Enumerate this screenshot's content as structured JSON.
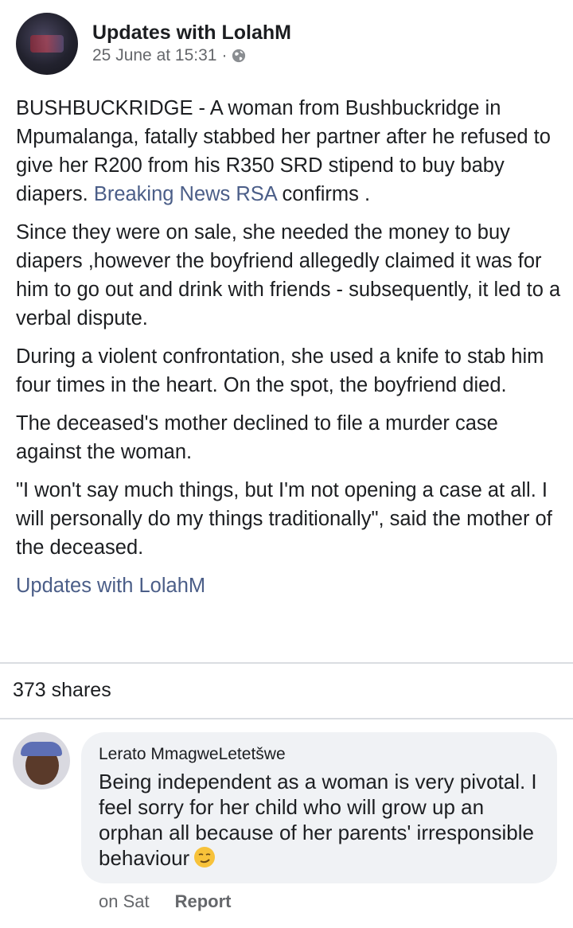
{
  "post": {
    "page_name": "Updates with LolahM",
    "timestamp": "25 June at 15:31",
    "privacy_icon": "globe-icon",
    "paragraphs": [
      {
        "text_before": "BUSHBUCKRIDGE - A woman from Bushbuckridge in Mpumalanga, fatally stabbed her partner after he refused to give her R200 from his R350 SRD stipend to buy baby diapers. ",
        "link": "Breaking News RSA",
        "text_after": " confirms ."
      },
      {
        "text": "Since they were on sale, she needed the money to buy diapers ,however the boyfriend allegedly claimed it was for him to go out and drink with friends - subsequently, it led to a verbal dispute."
      },
      {
        "text": "During a violent confrontation, she used a knife to stab him four times in the heart. On the spot, the boyfriend died."
      },
      {
        "text": "The deceased's mother declined to file a murder case against the woman."
      },
      {
        "text": "\"I won't say much things, but I'm not opening a case at all. I will personally do my things traditionally\", said the mother of the deceased."
      }
    ],
    "footer_link": "Updates with LolahM",
    "shares": "373 shares"
  },
  "comment": {
    "author": "Lerato MmagweLetetšwe",
    "text": "Being independent as a woman is very pivotal. I feel sorry for her child who will grow up an orphan all because of her parents' irresponsible behaviour",
    "emoji_icon": "smirk-emoji-icon",
    "time": "on Sat",
    "report_label": "Report"
  }
}
